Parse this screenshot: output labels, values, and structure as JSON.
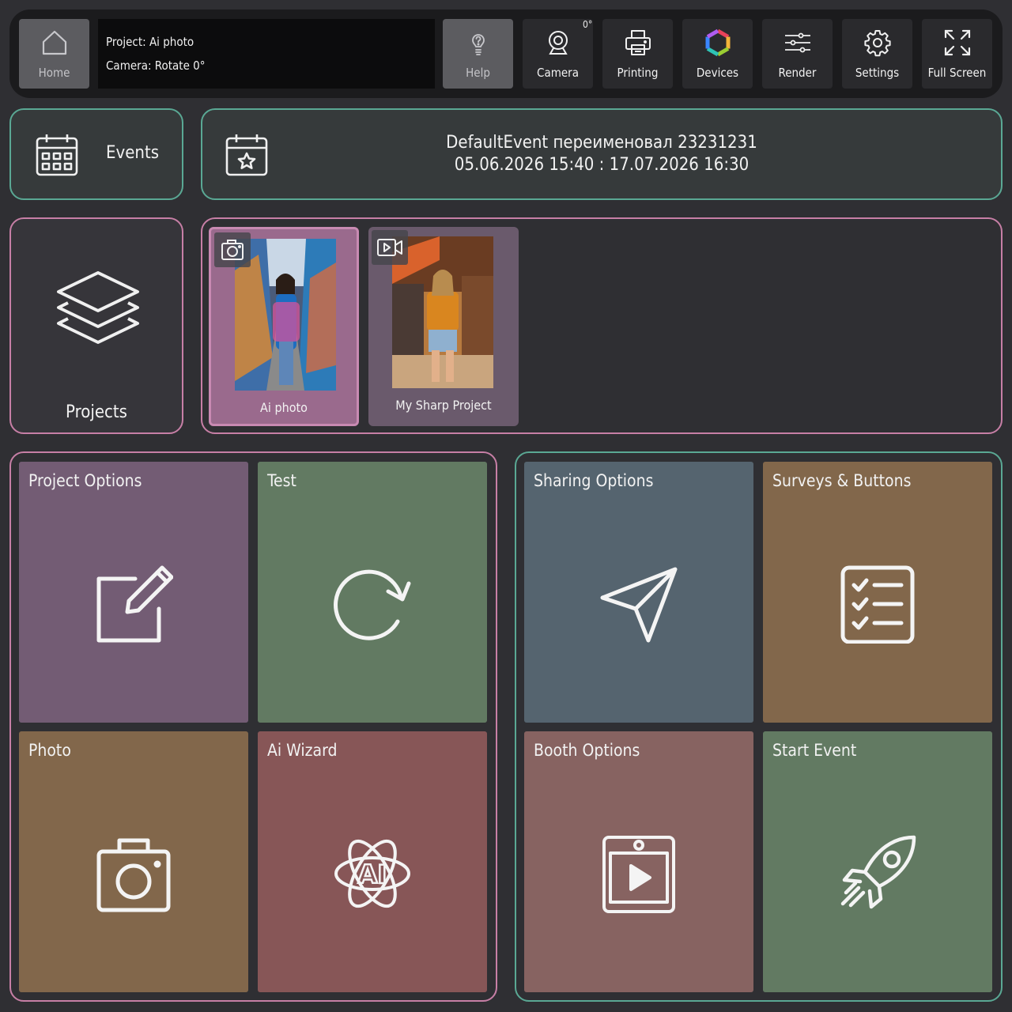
{
  "toolbar": {
    "home_label": "Home",
    "project_line": "Project: Ai photo",
    "camera_line": "Camera: Rotate 0°",
    "help_label": "Help",
    "camera_label": "Camera",
    "camera_rotation": "0°",
    "printing_label": "Printing",
    "devices_label": "Devices",
    "render_label": "Render",
    "settings_label": "Settings",
    "fullscreen_label": "Full Screen"
  },
  "events": {
    "label": "Events",
    "current_title": "DefaultEvent переименовал 23231231",
    "current_range": "05.06.2026 15:40 : 17.07.2026 16:30"
  },
  "projects": {
    "label": "Projects",
    "items": [
      {
        "name": "Ai photo",
        "type_icon": "camera-icon",
        "active": true
      },
      {
        "name": "My Sharp Project",
        "type_icon": "video-icon",
        "active": false
      }
    ]
  },
  "tiles": {
    "project_options": "Project Options",
    "test": "Test",
    "photo": "Photo",
    "ai_wizard": "Ai Wizard",
    "sharing_options": "Sharing Options",
    "surveys_buttons": "Surveys & Buttons",
    "booth_options": "Booth Options",
    "start_event": "Start Event"
  },
  "colors": {
    "teal_border": "#5aa894",
    "pink_border": "#c77fa6",
    "tile_purple": "#735c74",
    "tile_green": "#627a62",
    "tile_brown": "#82674b",
    "tile_red": "#875657",
    "tile_slate": "#55646f",
    "tile_mauve": "#876361"
  }
}
